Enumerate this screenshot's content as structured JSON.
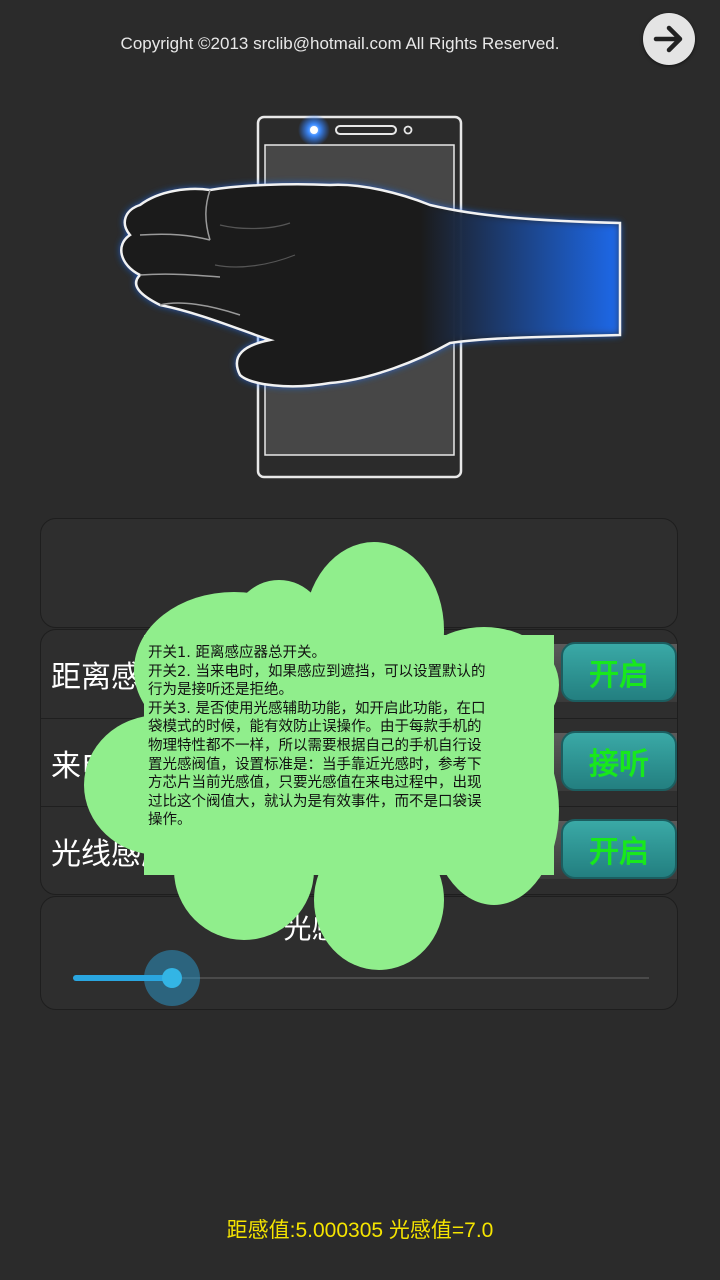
{
  "header": {
    "copyright": "Copyright ©2013 srclib@hotmail.com All Rights Reserved.",
    "next_icon": "arrow-right-icon"
  },
  "illustration": {
    "icon": "hand-over-phone-illustration"
  },
  "switches": [
    {
      "label": "距离感应器",
      "button": "开启"
    },
    {
      "label": "来电时",
      "button": "接听"
    },
    {
      "label": "光线感应器",
      "button": "开启"
    }
  ],
  "slider": {
    "title": "光感阀值:30",
    "fraction": 0.12
  },
  "help": {
    "lines": [
      "开关1. 距离感应器总开关。",
      "开关2. 当来电时，如果感应到遮挡，可以设置默认的行为是接听还是拒绝。",
      "开关3. 是否使用光感辅助功能，如开启此功能，在口袋模式的时候，能有效防止误操作。由于每款手机的物理特性都不一样，所以需要根据自己的手机自行设置光感阀值，设置标准是：当手靠近光感时，参考下方芯片当前光感值，只要光感值在来电过程中，出现过比这个阀值大，就认为是有效事件，而不是口袋误操作。"
    ]
  },
  "status": {
    "text": "距感值:5.000305 光感值=7.0"
  },
  "colors": {
    "background": "#2b2b2b",
    "button_text": "#18e81c",
    "accent": "#33b5e5",
    "status_text": "#f5e400",
    "cloud": "#90ee8c"
  }
}
